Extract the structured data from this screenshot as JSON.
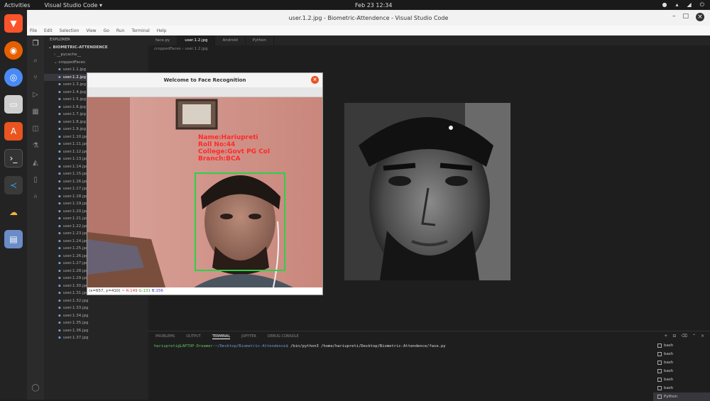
{
  "topbar": {
    "activities": "Activities",
    "app": "Visual Studio Code ▾",
    "clock": "Feb 23 12:34"
  },
  "window": {
    "title": "user.1.2.jpg - Biometric-Attendence - Visual Studio Code"
  },
  "menu": [
    "File",
    "Edit",
    "Selection",
    "View",
    "Go",
    "Run",
    "Terminal",
    "Help"
  ],
  "explorer": {
    "header": "EXPLORER",
    "section": "BIOMETRIC-ATTENDENCE",
    "folders": [
      "__pycache__",
      "croppedFaces"
    ],
    "files": [
      "user.1.1.jpg",
      "user.1.2.jpg",
      "user.1.3.jpg",
      "user.1.4.jpg",
      "user.1.5.jpg",
      "user.1.6.jpg",
      "user.1.7.jpg",
      "user.1.8.jpg",
      "user.1.9.jpg",
      "user.1.10.jpg",
      "user.1.11.jpg",
      "user.1.12.jpg",
      "user.1.13.jpg",
      "user.1.14.jpg",
      "user.1.15.jpg",
      "user.1.16.jpg",
      "user.1.17.jpg",
      "user.1.18.jpg",
      "user.1.19.jpg",
      "user.1.20.jpg",
      "user.1.21.jpg",
      "user.1.22.jpg",
      "user.1.23.jpg",
      "user.1.24.jpg",
      "user.1.25.jpg",
      "user.1.26.jpg",
      "user.1.27.jpg",
      "user.1.28.jpg",
      "user.1.29.jpg",
      "user.1.30.jpg",
      "user.1.31.jpg",
      "user.1.32.jpg",
      "user.1.33.jpg",
      "user.1.34.jpg",
      "user.1.35.jpg",
      "user.1.36.jpg",
      "user.1.37.jpg"
    ]
  },
  "tabs": [
    "face.py",
    "user.1.2.jpg",
    "Android",
    "Python"
  ],
  "breadcrumb": "croppedFaces  ›  user.1.2.jpg",
  "popup": {
    "title": "Welcome to Face Recognition",
    "overlay": [
      "Name:Hariupreti",
      "Roll No:44",
      "College:Govt PG Col",
      "Branch:BCA"
    ],
    "status_prefix": "(x=657, y=410) ~",
    "status_r": "R:149",
    "status_g": "G:131",
    "status_b": "B:156"
  },
  "panel": {
    "tabs": [
      "PROBLEMS",
      "OUTPUT",
      "TERMINAL",
      "JUPYTER",
      "DEBUG CONSOLE"
    ],
    "active_tab": "TERMINAL",
    "prompt_user": "hariupreti@LAPTOP-Dreamer",
    "prompt_path": ":~/Desktop/Biometric-Attendence$",
    "command": " /bin/python3 /home/hariupreti/Desktop/Biometric-Attendence/face.py",
    "terminals": [
      "bash",
      "bash",
      "bash",
      "bash",
      "bash",
      "bash",
      "Python"
    ]
  },
  "colors": {
    "accent": "#0e639c",
    "bbox": "#2bd14a",
    "overlay_text": "#ff2a2a"
  }
}
